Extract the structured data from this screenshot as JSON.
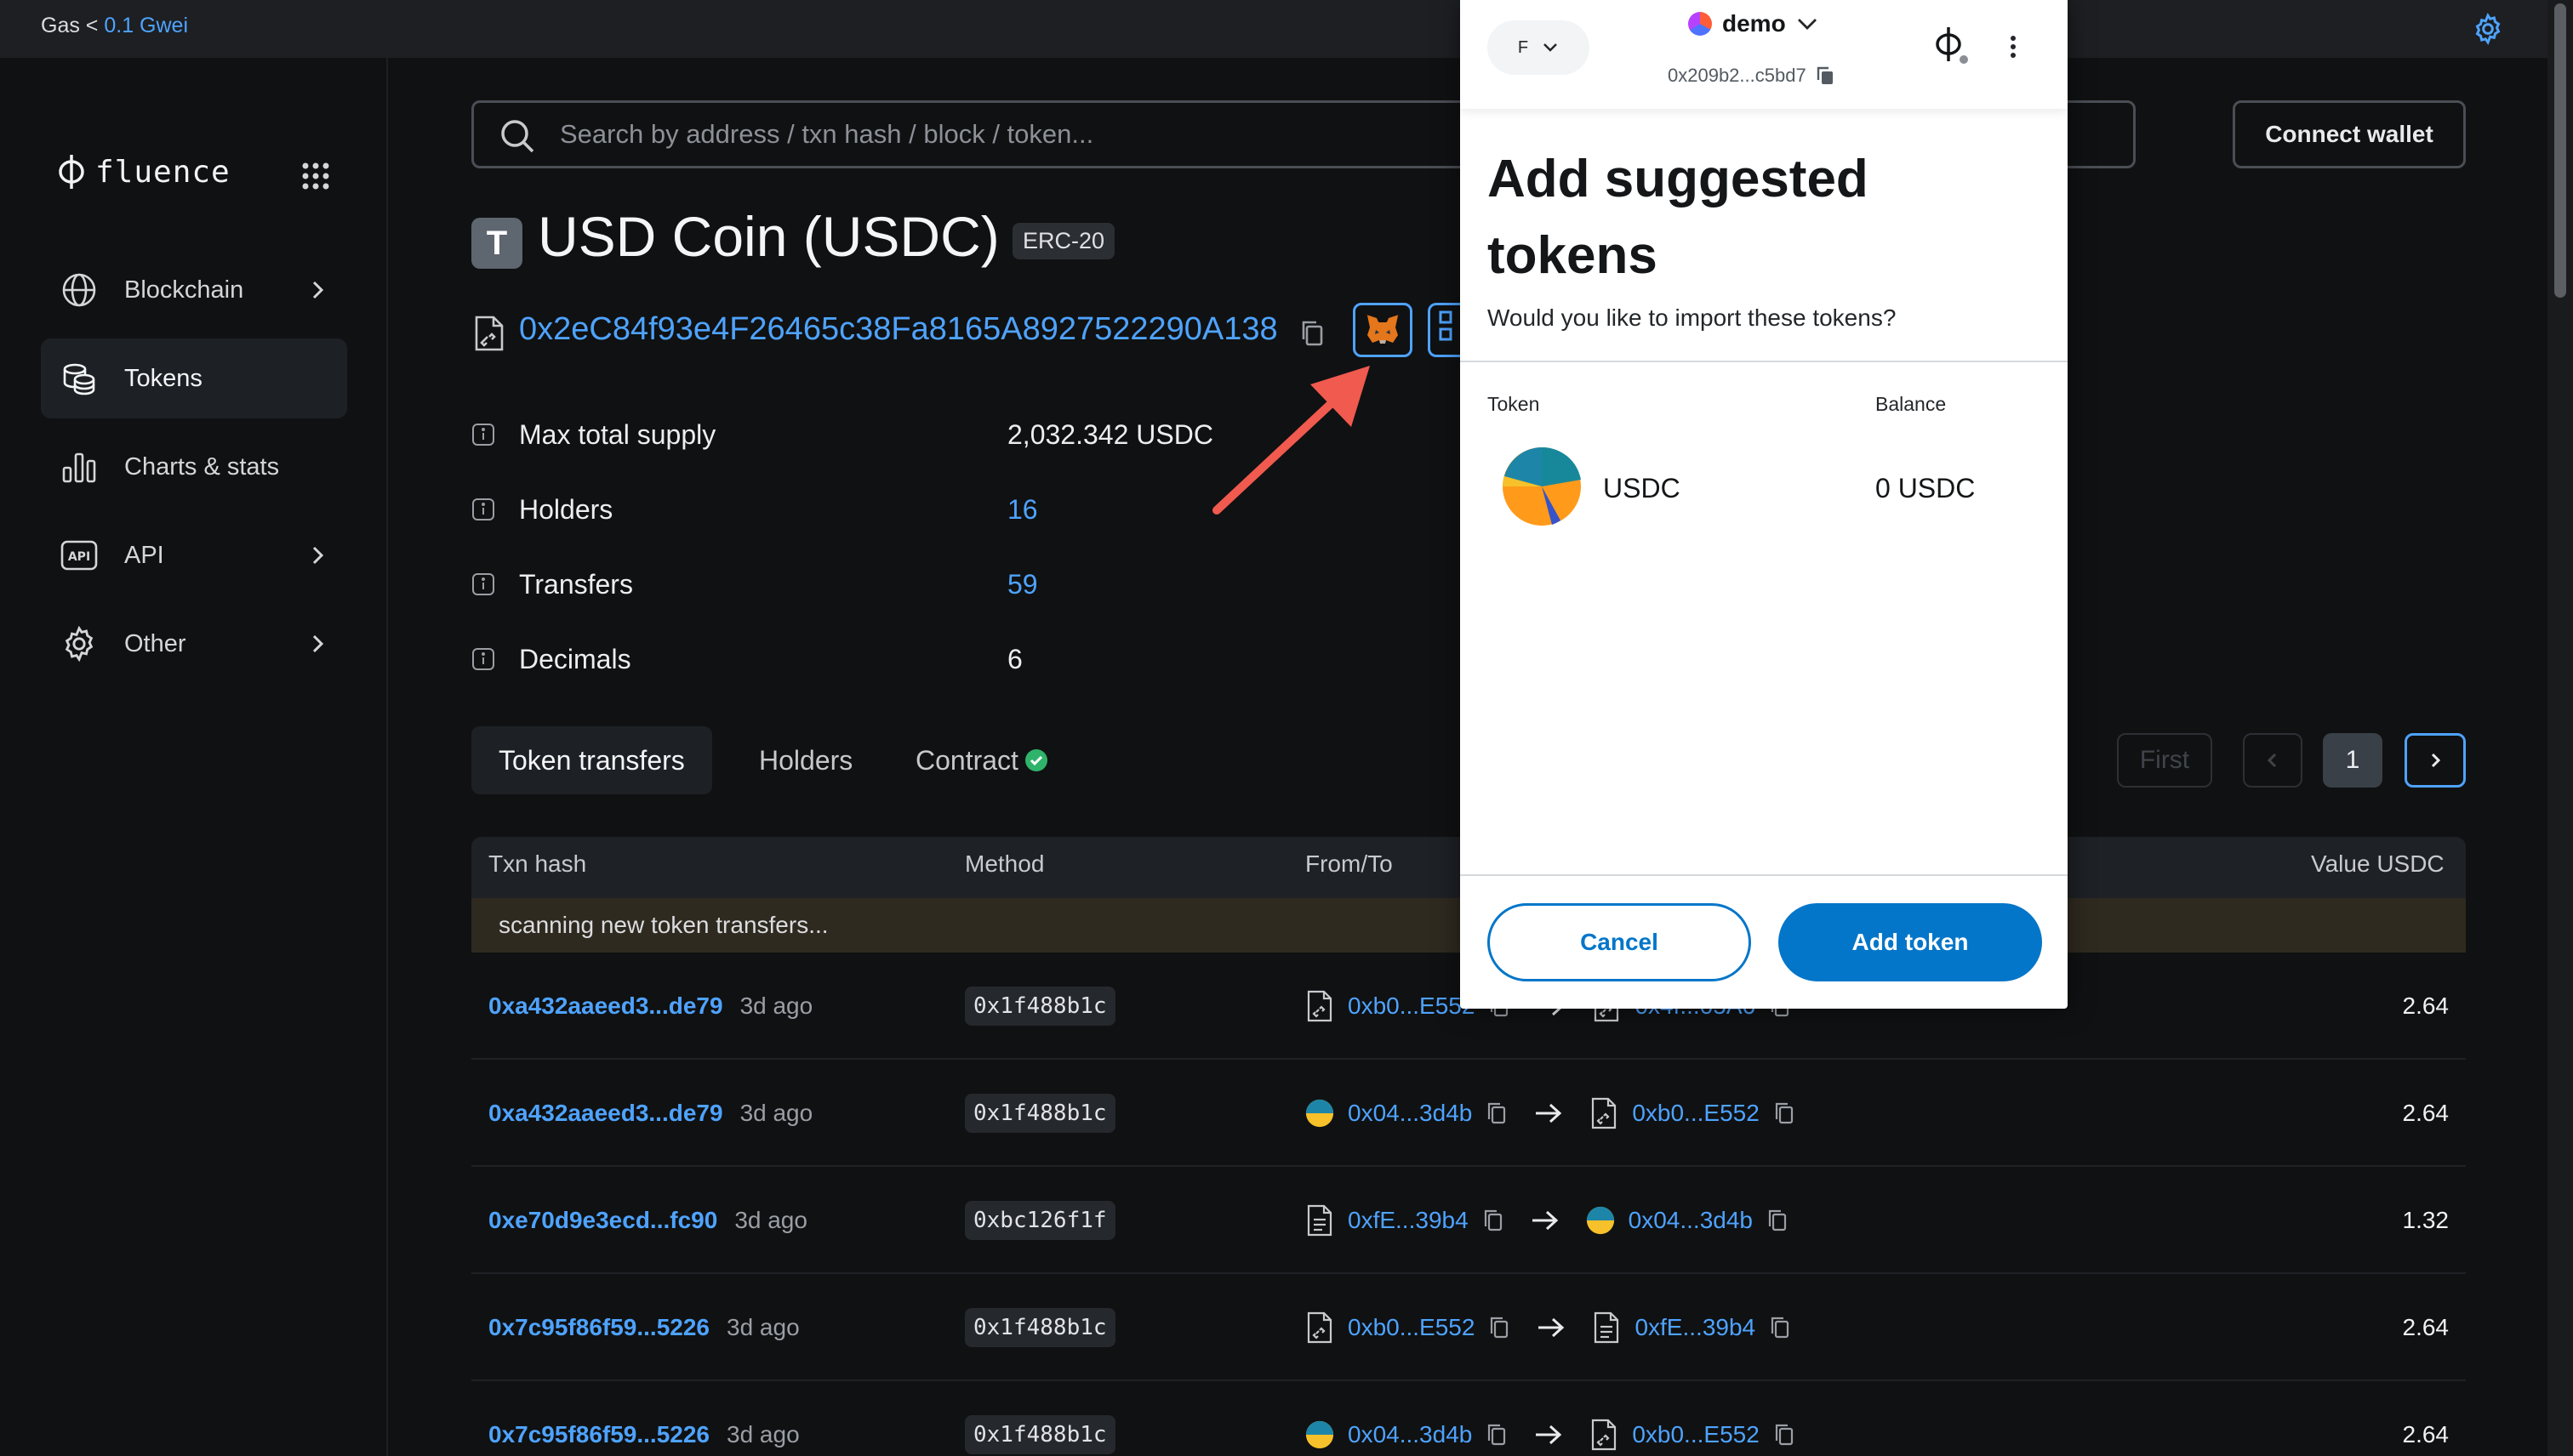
{
  "topbar": {
    "gas_label": "Gas <",
    "gas_value": "0.1 Gwei"
  },
  "brand": {
    "name": "fluence"
  },
  "sidebar": {
    "items": [
      {
        "label": "Blockchain",
        "icon": "globe-icon",
        "has_chevron": true,
        "active": false
      },
      {
        "label": "Tokens",
        "icon": "coins-icon",
        "has_chevron": false,
        "active": true
      },
      {
        "label": "Charts & stats",
        "icon": "bar-chart-icon",
        "has_chevron": false,
        "active": false
      },
      {
        "label": "API",
        "icon": "api-icon",
        "has_chevron": true,
        "active": false
      },
      {
        "label": "Other",
        "icon": "gear-icon",
        "has_chevron": true,
        "active": false
      }
    ]
  },
  "header": {
    "search_placeholder": "Search by address / txn hash / block / token...",
    "connect_wallet": "Connect wallet"
  },
  "token": {
    "badge_letter": "T",
    "title": "USD Coin (USDC)",
    "standard": "ERC-20",
    "contract_address": "0x2eC84f93e4F26465c38Fa8165A8927522290A138",
    "properties": [
      {
        "label": "Max total supply",
        "value": "2,032.342 USDC",
        "is_link": false
      },
      {
        "label": "Holders",
        "value": "16",
        "is_link": true
      },
      {
        "label": "Transfers",
        "value": "59",
        "is_link": true
      },
      {
        "label": "Decimals",
        "value": "6",
        "is_link": false
      }
    ]
  },
  "tabs": [
    {
      "label": "Token transfers",
      "active": true
    },
    {
      "label": "Holders",
      "active": false
    },
    {
      "label": "Contract",
      "active": false,
      "verified": true
    }
  ],
  "pagination": {
    "first": "First",
    "current": "1"
  },
  "table": {
    "headers": {
      "txn_hash": "Txn hash",
      "method": "Method",
      "from_to": "From/To",
      "value": "Value USDC"
    },
    "scanning_text": "scanning new token transfers...",
    "rows": [
      {
        "hash": "0xa432aaeed3...de79",
        "age": "3d ago",
        "method": "0x1f488b1c",
        "from": "0xb0...E552",
        "from_icon": "contract-icon",
        "to": "0x4f...05A6",
        "to_icon": "contract-icon",
        "value": "2.64"
      },
      {
        "hash": "0xa432aaeed3...de79",
        "age": "3d ago",
        "method": "0x1f488b1c",
        "from": "0x04...3d4b",
        "from_icon": "avatar-icon",
        "to": "0xb0...E552",
        "to_icon": "contract-icon",
        "value": "2.64"
      },
      {
        "hash": "0xe70d9e3ecd...fc90",
        "age": "3d ago",
        "method": "0xbc126f1f",
        "from": "0xfE...39b4",
        "from_icon": "document-icon",
        "to": "0x04...3d4b",
        "to_icon": "avatar-icon",
        "value": "1.32"
      },
      {
        "hash": "0x7c95f86f59...5226",
        "age": "3d ago",
        "method": "0x1f488b1c",
        "from": "0xb0...E552",
        "from_icon": "contract-icon",
        "to": "0xfE...39b4",
        "to_icon": "document-icon",
        "value": "2.64"
      },
      {
        "hash": "0x7c95f86f59...5226",
        "age": "3d ago",
        "method": "0x1f488b1c",
        "from": "0x04...3d4b",
        "from_icon": "avatar-icon",
        "to": "0xb0...E552",
        "to_icon": "contract-icon",
        "value": "2.64"
      }
    ]
  },
  "metamask": {
    "account_initial": "F",
    "network_name": "demo",
    "account_address": "0x209b2...c5bd7",
    "title": "Add suggested tokens",
    "subtitle": "Would you like to import these tokens?",
    "col_token": "Token",
    "col_balance": "Balance",
    "token_symbol": "USDC",
    "token_balance": "0 USDC",
    "cancel": "Cancel",
    "add_token": "Add token",
    "primary_color": "#0376c9"
  },
  "colors": {
    "link": "#4ea3ff",
    "annotation_arrow": "#f05a4f"
  }
}
